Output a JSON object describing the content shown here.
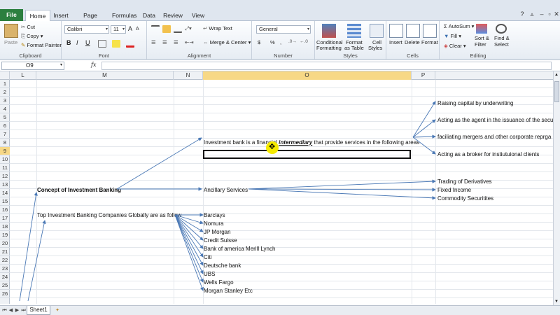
{
  "tabs": [
    "File",
    "Home",
    "Insert",
    "Page Layout",
    "Formulas",
    "Data",
    "Review",
    "View"
  ],
  "ribbon": {
    "clipboard": {
      "paste": "Paste",
      "cut": "Cut",
      "copy": "Copy",
      "format_painter": "Format Painter",
      "label": "Clipboard"
    },
    "font": {
      "name": "Calibri",
      "size": "11",
      "label": "Font",
      "bold": "B",
      "italic": "I",
      "underline": "U",
      "grow": "A",
      "shrink": "A"
    },
    "alignment": {
      "wrap": "Wrap Text",
      "merge": "Merge & Center",
      "label": "Alignment"
    },
    "number": {
      "format": "General",
      "currency": "$",
      "percent": "%",
      "comma": ",",
      "label": "Number"
    },
    "styles": {
      "conditional_1": "Conditional",
      "conditional_2": "Formatting",
      "format_table_1": "Format",
      "format_table_2": "as Table",
      "cell_styles_1": "Cell",
      "cell_styles_2": "Styles",
      "label": "Styles"
    },
    "cells": {
      "insert": "Insert",
      "delete": "Delete",
      "format": "Format",
      "label": "Cells"
    },
    "editing": {
      "autosum": "AutoSum",
      "fill": "Fill",
      "clear": "Clear",
      "sort_1": "Sort &",
      "sort_2": "Filter",
      "find_1": "Find &",
      "find_2": "Select",
      "label": "Editing"
    }
  },
  "formula_bar": {
    "name_box": "O9",
    "fx": "fx",
    "value": ""
  },
  "columns": [
    "L",
    "M",
    "N",
    "O",
    "P"
  ],
  "rows": [
    "1",
    "2",
    "3",
    "4",
    "5",
    "6",
    "7",
    "8",
    "9",
    "10",
    "11",
    "12",
    "13",
    "14",
    "15",
    "16",
    "17",
    "18",
    "19",
    "20",
    "21",
    "22",
    "23",
    "24",
    "25",
    "26"
  ],
  "cells": {
    "investment_bank_a": "Investment bank is a financial ",
    "investment_bank_b": "intermediary",
    "investment_bank_c": " that provide services in the following areas",
    "raising": "Raising capital by underwriting",
    "agent": "Acting as the agent in the issuance of the secu",
    "mergers": "faciliating mergers and other corporate reprga",
    "broker": "Acting as a broker for instiutuional clients",
    "concept": "Concept of Investment Banking",
    "ancillary": "Ancillary Services",
    "derivatives": "Trading of Derivatives",
    "fixed_income": "Fixed Income",
    "commodity": "Commodity Securitites",
    "top_companies": "Top Investment Banking Companies Globally are as follow",
    "companies": [
      "Barclays",
      "Nomura",
      "JP Morgan",
      "Credit Suisse",
      "Bank of america Merill Lynch",
      "Citi",
      "Deutsche bank",
      "UBS",
      "Wells Fargo",
      "Morgan Stanley Etc"
    ]
  },
  "sheet": {
    "name": "Sheet1"
  }
}
